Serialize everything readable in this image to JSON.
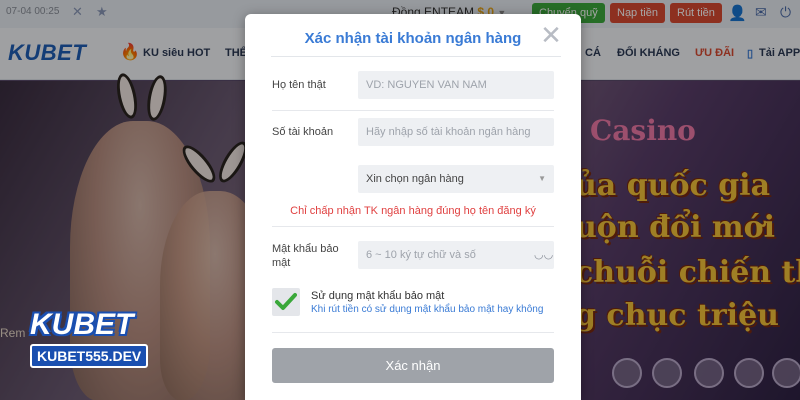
{
  "topbar": {
    "datetime": "07-04 00:25",
    "icons": [
      "close-icon",
      "star-icon",
      "user-icon",
      "mail-icon",
      "power-icon"
    ],
    "account_label": "Đồng",
    "account_name": "ENTEAM",
    "balance": "$ 0",
    "buttons": {
      "transfer": "Chuyển quỹ",
      "deposit": "Nạp tiền",
      "withdraw": "Rút tiền"
    },
    "colors": {
      "green": "#3caa3c",
      "red": "#d94a32"
    }
  },
  "navbar": {
    "logo": "KUBET",
    "items": [
      "KU siêu HOT",
      "THỂ",
      "CÁ",
      "ĐỐI KHÁNG",
      "ƯU ĐÃI",
      "Tải APP"
    ],
    "icons": [
      "fire-icon",
      "phone-icon"
    ]
  },
  "banner": {
    "casino": "Casino",
    "promo_lines": [
      "ủa quốc gia",
      "uộn đổi mới",
      "chuỗi chiến th",
      "g chục triệu"
    ],
    "remember_label": "Rem",
    "watermark": {
      "logo": "KUBET",
      "url": "KUBET555.DEV"
    }
  },
  "modal": {
    "title": "Xác nhận tài khoản ngân hàng",
    "accent": "#3a7bd5",
    "fields": {
      "real_name": {
        "label": "Họ tên thật",
        "placeholder": "VD: NGUYEN VAN NAM",
        "value": ""
      },
      "account_number": {
        "label": "Số tài khoản",
        "placeholder": "Hãy nhập số tài khoản ngân hàng",
        "value": ""
      },
      "bank": {
        "selected": "Xin chọn ngân hàng"
      },
      "security_password": {
        "label": "Mật khẩu bảo mật",
        "placeholder": "6 ~ 10 ký tự chữ và số",
        "value": ""
      }
    },
    "warning": "Chỉ chấp nhận TK ngân hàng đúng họ tên đăng ký",
    "warning_color": "#e04040",
    "use_security": {
      "checked": true,
      "label": "Sử dụng mật khẩu bảo mật",
      "note": "Khi rút tiền có sử dụng mật khẩu bảo mật hay không"
    },
    "submit_label": "Xác nhận",
    "close_icon": "close-icon"
  }
}
